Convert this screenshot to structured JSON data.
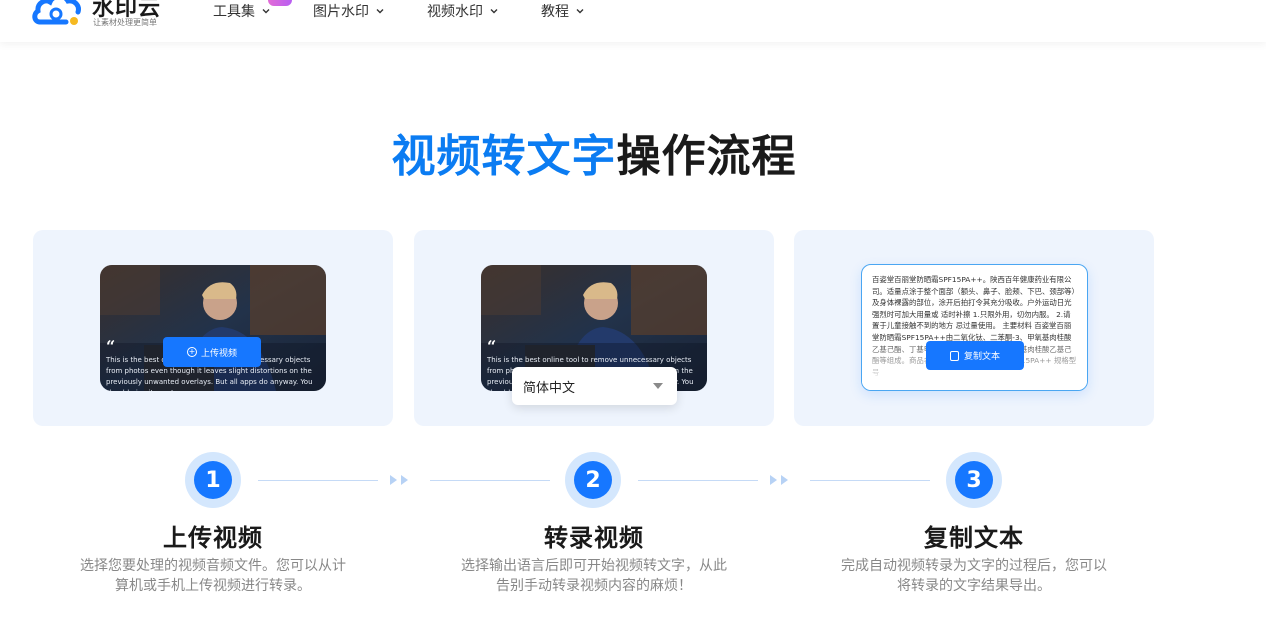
{
  "nav": {
    "logo_name": "水印云",
    "logo_slogan": "让素材处理更简单",
    "menu": [
      {
        "label": "工具集"
      },
      {
        "label": "图片水印"
      },
      {
        "label": "视频水印"
      },
      {
        "label": "教程"
      }
    ]
  },
  "title": {
    "highlight": "视频转文字",
    "rest": "操作流程"
  },
  "cards": {
    "quote_text": "This is the best online tool to remove unnecessary objects from photos even though it leaves slight distortions on the previously unwanted overlays. But all apps do anyway. You should give it a go!",
    "upload_label": "上传视频",
    "select_value": "简体中文",
    "doc_text": "百姿堂百丽堂防晒霜SPF15PA++。陕西百年健康药业有限公司。适量点涂于整个面部（额头、鼻子、脸颊、下巴、颈部等）及身体裸露的部位，涂开后拍打令其充分吸收。户外运动日光强烈时可加大用量或 适时补擦 1.只限外用，切勿内服。 2.请置于儿童接触不到的地方 忌过量使用。 主要材料 百姿堂百丽堂防晒霜SPF15PA++由二氧化钛、二苯酮-3、甲氧基肉桂酸乙基己酯、丁基甲氧基二苯甲酰基甲烷、甲氧基肉桂酸乙基己酯等组成。商品名称 百姿堂百丽堂防晒霜SPF15PA++ 规格型号",
    "copy_label": "复制文本"
  },
  "steps": [
    {
      "number": "1",
      "title": "上传视频",
      "desc_line1": "选择您要处理的视频音频文件。您可以从计",
      "desc_line2": "算机或手机上传视频进行转录。"
    },
    {
      "number": "2",
      "title": "转录视频",
      "desc_line1": "选择输出语言后即可开始视频转文字，从此",
      "desc_line2": "告别手动转录视频内容的麻烦！"
    },
    {
      "number": "3",
      "title": "复制文本",
      "desc_line1": "完成自动视频转录为文字的过程后，您可以",
      "desc_line2": "将转录的文字结果导出。"
    }
  ],
  "colors": {
    "accent": "#1677ff",
    "title_highlight": "#0b7cf2",
    "card_bg": "#eef4fd"
  }
}
